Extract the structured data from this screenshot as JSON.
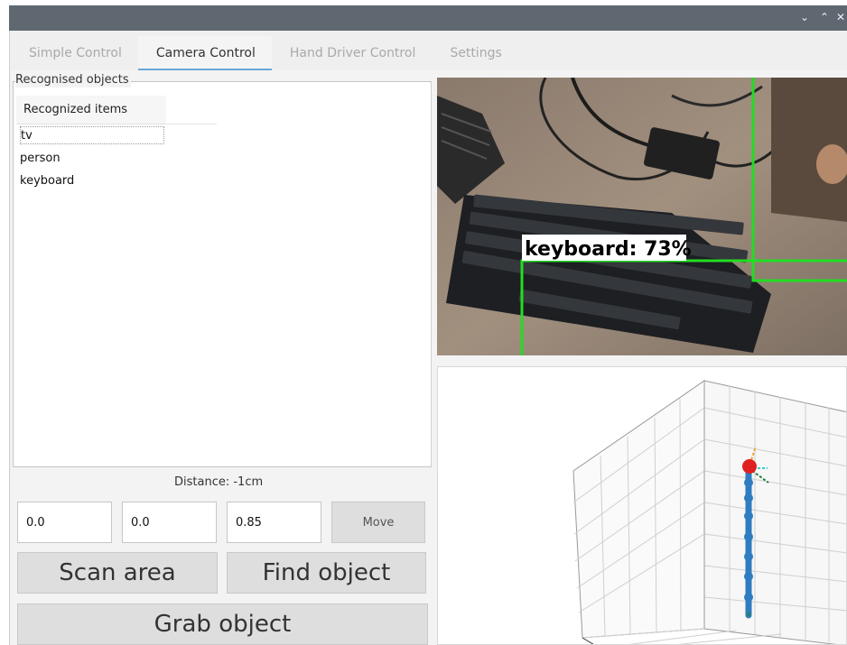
{
  "window": {
    "controls": {
      "minimize": "⌄",
      "maximize": "⌃",
      "close": "✕"
    }
  },
  "tabs": [
    {
      "label": "Simple Control",
      "active": false
    },
    {
      "label": "Camera Control",
      "active": true
    },
    {
      "label": "Hand Driver Control",
      "active": false
    },
    {
      "label": "Settings",
      "active": false
    }
  ],
  "recognised": {
    "group_title": "Recognised objects",
    "column_header": "Recognized items",
    "items": [
      "tv",
      "person",
      "keyboard"
    ],
    "selected_index": 0
  },
  "distance": {
    "label": "Distance: -1cm"
  },
  "move": {
    "x_value": "0.0",
    "y_value": "0.0",
    "z_value": "0.85",
    "button_label": "Move"
  },
  "actions": {
    "scan_label": "Scan area",
    "find_label": "Find object",
    "grab_label": "Grab object"
  },
  "camera": {
    "detection_label": "keyboard: 73%",
    "box_color": "#22dd22"
  },
  "colors": {
    "accent_tab": "#6aa6d6",
    "arm": "#2f7dc0",
    "end_effector": "#e02020"
  }
}
